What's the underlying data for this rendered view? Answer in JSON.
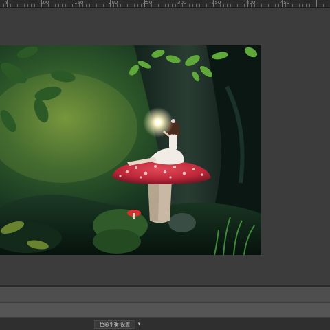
{
  "ruler": {
    "labels": [
      "8",
      "100",
      "150",
      "200",
      "250",
      "300",
      "350",
      "400",
      "450"
    ]
  },
  "artwork": {
    "subject": "fairy-mushroom-forest-photo"
  },
  "bottom_panel": {
    "preset_label": "色彩平衡 设置",
    "dropdown_icon": "chevron-down-icon"
  },
  "colors": {
    "ruler_bg": "#2b2b2b",
    "workspace_bg": "#3c3c3c",
    "panel_bg": "#505050",
    "mushroom_cap": "#c0283a",
    "glow": "#fff4c2"
  }
}
